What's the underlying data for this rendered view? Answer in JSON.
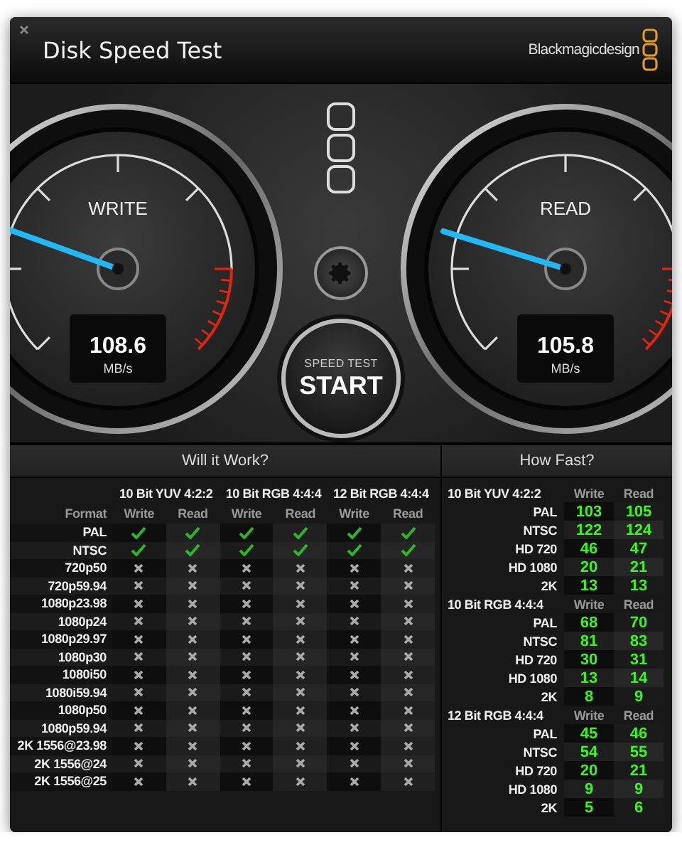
{
  "window": {
    "title": "Disk Speed Test",
    "brand": "Blackmagicdesign"
  },
  "gauges": [
    {
      "label": "WRITE",
      "value": "108.6",
      "unit": "MB/s",
      "level": 0.24
    },
    {
      "label": "READ",
      "value": "105.8",
      "unit": "MB/s",
      "level": 0.23
    }
  ],
  "start_button": {
    "caption": "SPEED TEST",
    "label": "START"
  },
  "will_it_work": {
    "title": "Will it Work?",
    "format_heading": "Format",
    "groups": [
      {
        "name": "10 Bit YUV 4:2:2",
        "columns": [
          "Write",
          "Read"
        ]
      },
      {
        "name": "10 Bit RGB 4:4:4",
        "columns": [
          "Write",
          "Read"
        ]
      },
      {
        "name": "12 Bit RGB 4:4:4",
        "columns": [
          "Write",
          "Read"
        ]
      }
    ],
    "rows": [
      {
        "format": "PAL",
        "results": [
          true,
          true,
          true,
          true,
          true,
          true
        ]
      },
      {
        "format": "NTSC",
        "results": [
          true,
          true,
          true,
          true,
          true,
          true
        ]
      },
      {
        "format": "720p50",
        "results": [
          false,
          false,
          false,
          false,
          false,
          false
        ]
      },
      {
        "format": "720p59.94",
        "results": [
          false,
          false,
          false,
          false,
          false,
          false
        ]
      },
      {
        "format": "1080p23.98",
        "results": [
          false,
          false,
          false,
          false,
          false,
          false
        ]
      },
      {
        "format": "1080p24",
        "results": [
          false,
          false,
          false,
          false,
          false,
          false
        ]
      },
      {
        "format": "1080p29.97",
        "results": [
          false,
          false,
          false,
          false,
          false,
          false
        ]
      },
      {
        "format": "1080p30",
        "results": [
          false,
          false,
          false,
          false,
          false,
          false
        ]
      },
      {
        "format": "1080i50",
        "results": [
          false,
          false,
          false,
          false,
          false,
          false
        ]
      },
      {
        "format": "1080i59.94",
        "results": [
          false,
          false,
          false,
          false,
          false,
          false
        ]
      },
      {
        "format": "1080p50",
        "results": [
          false,
          false,
          false,
          false,
          false,
          false
        ]
      },
      {
        "format": "1080p59.94",
        "results": [
          false,
          false,
          false,
          false,
          false,
          false
        ]
      },
      {
        "format": "2K 1556@23.98",
        "results": [
          false,
          false,
          false,
          false,
          false,
          false
        ]
      },
      {
        "format": "2K 1556@24",
        "results": [
          false,
          false,
          false,
          false,
          false,
          false
        ]
      },
      {
        "format": "2K 1556@25",
        "results": [
          false,
          false,
          false,
          false,
          false,
          false
        ]
      }
    ]
  },
  "how_fast": {
    "title": "How Fast?",
    "groups": [
      {
        "name": "10 Bit YUV 4:2:2",
        "columns": [
          "Write",
          "Read"
        ],
        "rows": [
          {
            "format": "PAL",
            "write": "103",
            "read": "105"
          },
          {
            "format": "NTSC",
            "write": "122",
            "read": "124"
          },
          {
            "format": "HD 720",
            "write": "46",
            "read": "47"
          },
          {
            "format": "HD 1080",
            "write": "20",
            "read": "21"
          },
          {
            "format": "2K",
            "write": "13",
            "read": "13"
          }
        ]
      },
      {
        "name": "10 Bit RGB 4:4:4",
        "columns": [
          "Write",
          "Read"
        ],
        "rows": [
          {
            "format": "PAL",
            "write": "68",
            "read": "70"
          },
          {
            "format": "NTSC",
            "write": "81",
            "read": "83"
          },
          {
            "format": "HD 720",
            "write": "30",
            "read": "31"
          },
          {
            "format": "HD 1080",
            "write": "13",
            "read": "14"
          },
          {
            "format": "2K",
            "write": "8",
            "read": "9"
          }
        ]
      },
      {
        "name": "12 Bit RGB 4:4:4",
        "columns": [
          "Write",
          "Read"
        ],
        "rows": [
          {
            "format": "PAL",
            "write": "45",
            "read": "46"
          },
          {
            "format": "NTSC",
            "write": "54",
            "read": "55"
          },
          {
            "format": "HD 720",
            "write": "20",
            "read": "21"
          },
          {
            "format": "HD 1080",
            "write": "9",
            "read": "9"
          },
          {
            "format": "2K",
            "write": "5",
            "read": "6"
          }
        ]
      }
    ]
  }
}
